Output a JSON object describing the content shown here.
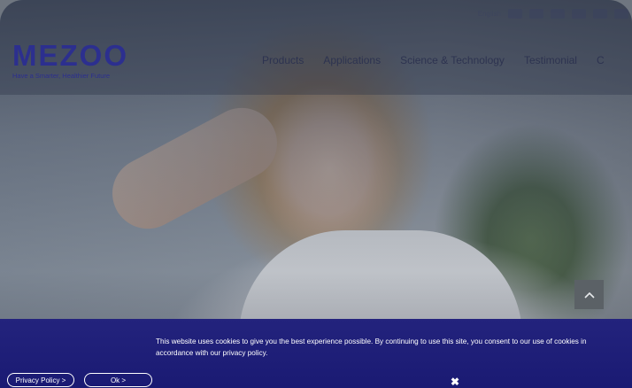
{
  "brand": {
    "name": "MEZOO",
    "tagline": "Have a Smarter, Healthier Future"
  },
  "topbar": {
    "language_label": "English"
  },
  "nav": {
    "items": [
      "Products",
      "Applications",
      "Science & Technology",
      "Testimonial",
      "C"
    ]
  },
  "cookie_banner": {
    "message": "This website uses cookies to give you the best experience possible. By continuing to use this site, you consent to our use of cookies in accordance with our privacy policy.",
    "privacy_button": "Privacy Policy >",
    "ok_button": "Ok >",
    "close_symbol": "✖"
  },
  "colors": {
    "brand_navy": "#2c2f8f",
    "banner_bg": "#1f1f78",
    "scroll_button_bg": "#5b6166"
  },
  "icons": [
    "scroll-top-icon",
    "close-icon"
  ]
}
